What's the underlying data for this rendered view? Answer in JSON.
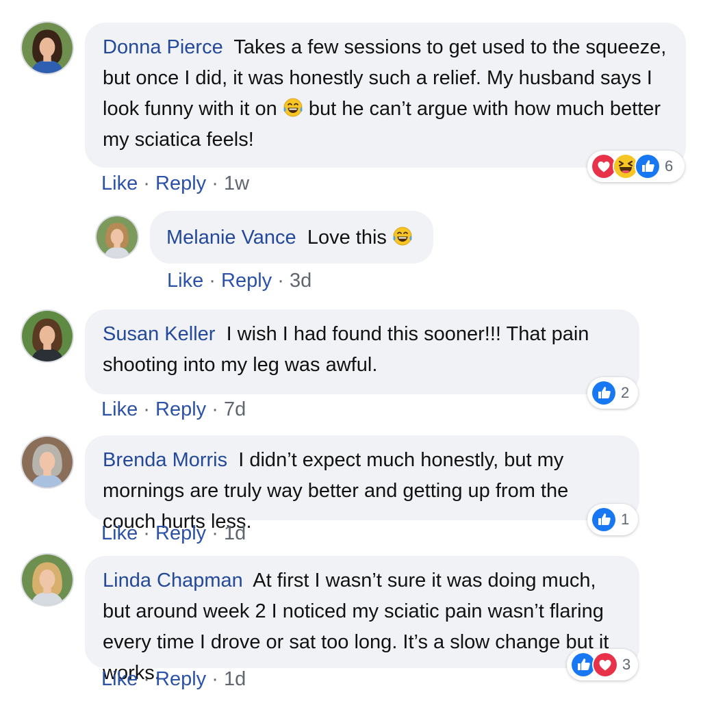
{
  "comments": [
    {
      "name": "Donna Pierce",
      "text_a": "Takes a few sessions to get used to the squeeze, but once I did, it was honestly such a relief. My husband says I look funny with it on",
      "emoji": "laughing-tears-emoji",
      "text_b": "but he can’t argue with how much better my sciatica feels!",
      "like": "Like",
      "reply": "Reply",
      "time": "1w",
      "reactions": [
        "love-icon",
        "haha-icon",
        "like-icon"
      ],
      "count": "6"
    },
    {
      "name": "Melanie Vance",
      "text": "Love this",
      "emoji": "laughing-tears-emoji",
      "like": "Like",
      "reply": "Reply",
      "time": "3d"
    },
    {
      "name": "Susan Keller",
      "text": "I wish I had found this sooner!!! That pain shooting into my leg was awful.",
      "like": "Like",
      "reply": "Reply",
      "time": "7d",
      "reactions": [
        "like-icon"
      ],
      "count": "2"
    },
    {
      "name": "Brenda Morris",
      "text": "I didn’t expect much honestly, but my mornings are truly way better and getting up from the couch hurts less.",
      "like": "Like",
      "reply": "Reply",
      "time": "1d",
      "reactions": [
        "like-icon"
      ],
      "count": "1"
    },
    {
      "name": "Linda Chapman",
      "text": "At first I wasn’t sure it was doing much, but around week 2 I noticed my sciatic pain wasn’t flaring every time I drove or sat too long. It’s a slow change but it works.",
      "like": "Like",
      "reply": "Reply",
      "time": "1d",
      "reactions": [
        "like-icon",
        "love-icon"
      ],
      "count": "3"
    }
  ],
  "separator": "·",
  "colors": {
    "name": "#24489a",
    "bubble": "#f0f2f5",
    "like_blue": "#1877f2",
    "love_red": "#e8324a",
    "haha_yellow": "#f7c625"
  }
}
